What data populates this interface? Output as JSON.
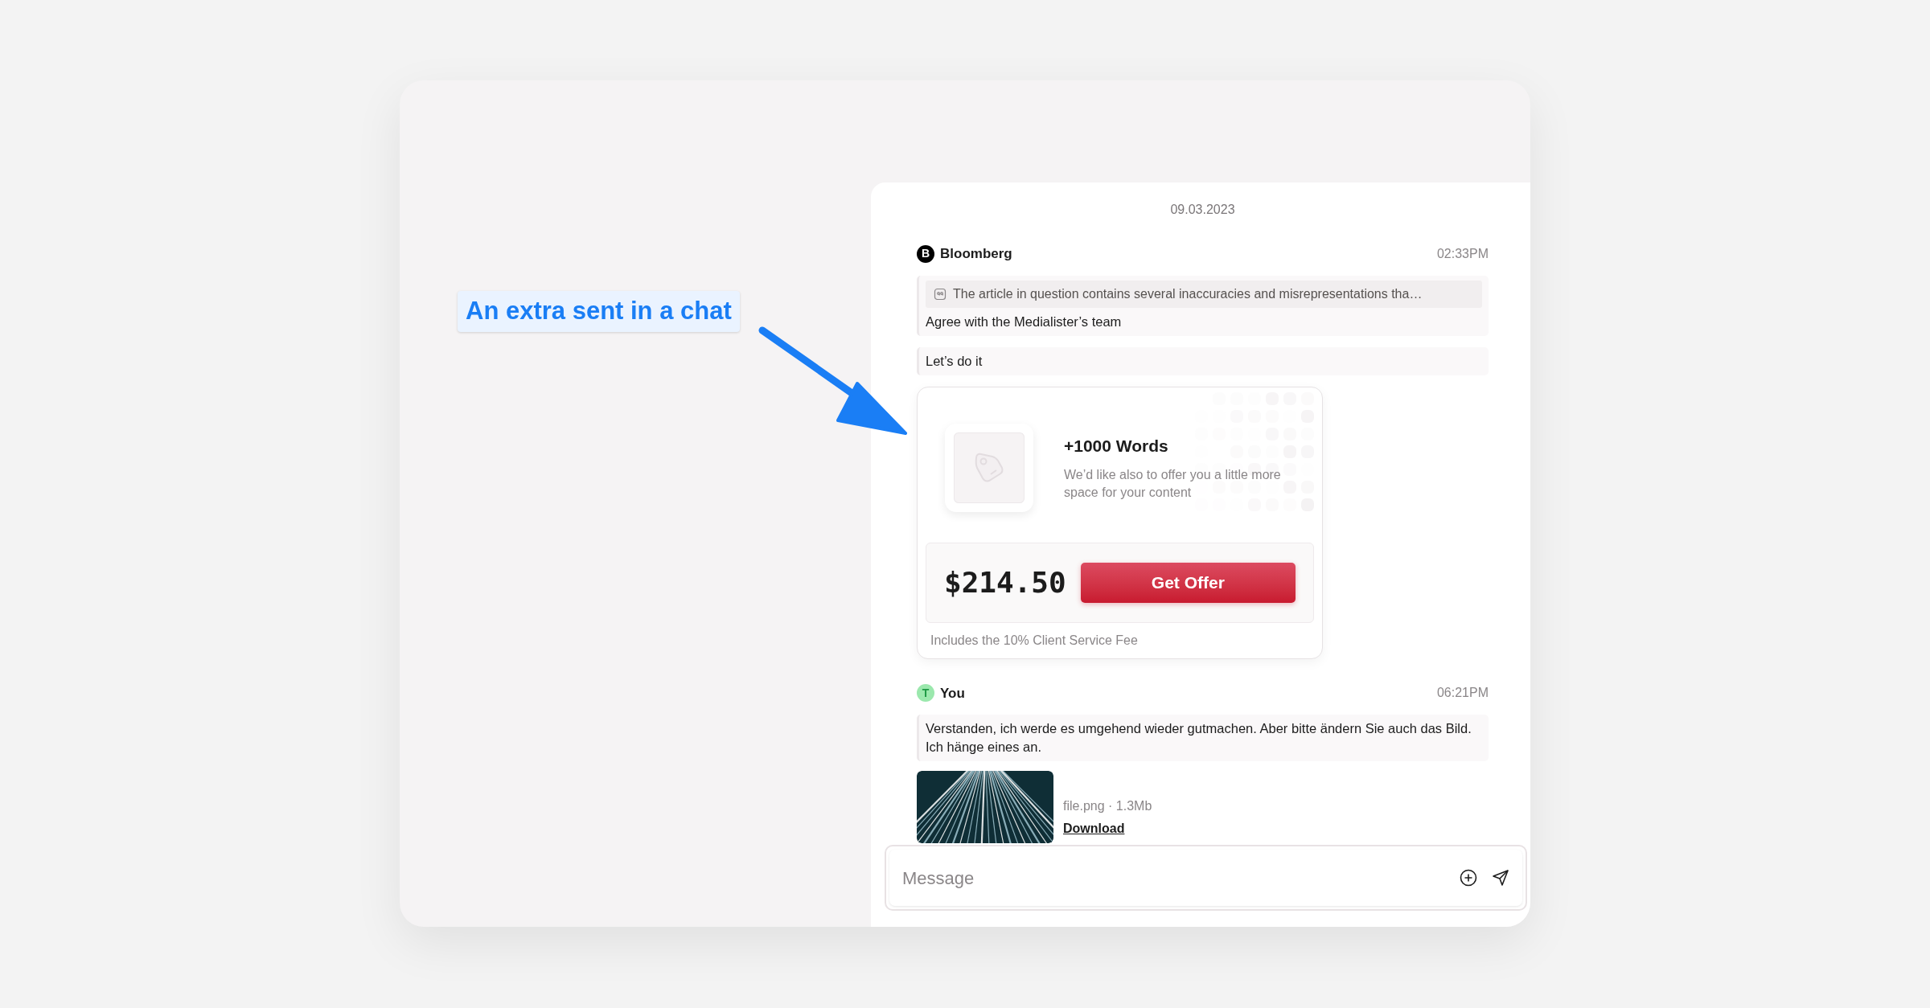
{
  "annotation": {
    "label": "An extra sent in a chat"
  },
  "chat": {
    "date": "09.03.2023",
    "messages": [
      {
        "kind": "incoming",
        "sender": "Bloomberg",
        "avatar": "B",
        "color": "#000000",
        "time": "02:33PM",
        "bubbles": [
          {
            "quote": "The article in question contains several inaccuracies and misrepresentations tha…",
            "text": "Agree with the Medialister’s team"
          },
          {
            "text": "Let’s do it"
          }
        ],
        "offer": {
          "title": "+1000 Words",
          "description": "We’d like also to offer you a little more space for your content",
          "price": "$214.50",
          "button": "Get Offer",
          "note": "Includes the 10% Client Service Fee"
        }
      },
      {
        "kind": "outgoing",
        "sender": "You",
        "avatar": "T",
        "color": "#9be8ad",
        "time": "06:21PM",
        "bubbles": [
          {
            "text": "Verstanden, ich werde es umgehend wieder gutmachen. Aber bitte ändern Sie auch das Bild. Ich hänge eines an."
          }
        ],
        "attachment": {
          "meta": "file.png · 1.3Mb",
          "link": "Download"
        }
      }
    ]
  },
  "composer": {
    "placeholder": "Message"
  }
}
